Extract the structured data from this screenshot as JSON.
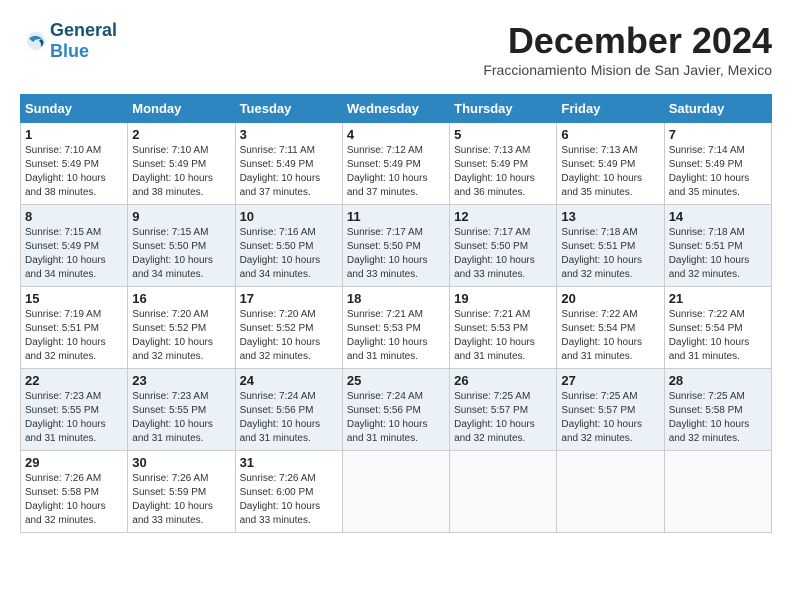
{
  "header": {
    "logo_general": "General",
    "logo_blue": "Blue",
    "month_title": "December 2024",
    "subtitle": "Fraccionamiento Mision de San Javier, Mexico"
  },
  "days_of_week": [
    "Sunday",
    "Monday",
    "Tuesday",
    "Wednesday",
    "Thursday",
    "Friday",
    "Saturday"
  ],
  "weeks": [
    [
      {
        "day": "1",
        "info": "Sunrise: 7:10 AM\nSunset: 5:49 PM\nDaylight: 10 hours\nand 38 minutes."
      },
      {
        "day": "2",
        "info": "Sunrise: 7:10 AM\nSunset: 5:49 PM\nDaylight: 10 hours\nand 38 minutes."
      },
      {
        "day": "3",
        "info": "Sunrise: 7:11 AM\nSunset: 5:49 PM\nDaylight: 10 hours\nand 37 minutes."
      },
      {
        "day": "4",
        "info": "Sunrise: 7:12 AM\nSunset: 5:49 PM\nDaylight: 10 hours\nand 37 minutes."
      },
      {
        "day": "5",
        "info": "Sunrise: 7:13 AM\nSunset: 5:49 PM\nDaylight: 10 hours\nand 36 minutes."
      },
      {
        "day": "6",
        "info": "Sunrise: 7:13 AM\nSunset: 5:49 PM\nDaylight: 10 hours\nand 35 minutes."
      },
      {
        "day": "7",
        "info": "Sunrise: 7:14 AM\nSunset: 5:49 PM\nDaylight: 10 hours\nand 35 minutes."
      }
    ],
    [
      {
        "day": "8",
        "info": "Sunrise: 7:15 AM\nSunset: 5:49 PM\nDaylight: 10 hours\nand 34 minutes."
      },
      {
        "day": "9",
        "info": "Sunrise: 7:15 AM\nSunset: 5:50 PM\nDaylight: 10 hours\nand 34 minutes."
      },
      {
        "day": "10",
        "info": "Sunrise: 7:16 AM\nSunset: 5:50 PM\nDaylight: 10 hours\nand 34 minutes."
      },
      {
        "day": "11",
        "info": "Sunrise: 7:17 AM\nSunset: 5:50 PM\nDaylight: 10 hours\nand 33 minutes."
      },
      {
        "day": "12",
        "info": "Sunrise: 7:17 AM\nSunset: 5:50 PM\nDaylight: 10 hours\nand 33 minutes."
      },
      {
        "day": "13",
        "info": "Sunrise: 7:18 AM\nSunset: 5:51 PM\nDaylight: 10 hours\nand 32 minutes."
      },
      {
        "day": "14",
        "info": "Sunrise: 7:18 AM\nSunset: 5:51 PM\nDaylight: 10 hours\nand 32 minutes."
      }
    ],
    [
      {
        "day": "15",
        "info": "Sunrise: 7:19 AM\nSunset: 5:51 PM\nDaylight: 10 hours\nand 32 minutes."
      },
      {
        "day": "16",
        "info": "Sunrise: 7:20 AM\nSunset: 5:52 PM\nDaylight: 10 hours\nand 32 minutes."
      },
      {
        "day": "17",
        "info": "Sunrise: 7:20 AM\nSunset: 5:52 PM\nDaylight: 10 hours\nand 32 minutes."
      },
      {
        "day": "18",
        "info": "Sunrise: 7:21 AM\nSunset: 5:53 PM\nDaylight: 10 hours\nand 31 minutes."
      },
      {
        "day": "19",
        "info": "Sunrise: 7:21 AM\nSunset: 5:53 PM\nDaylight: 10 hours\nand 31 minutes."
      },
      {
        "day": "20",
        "info": "Sunrise: 7:22 AM\nSunset: 5:54 PM\nDaylight: 10 hours\nand 31 minutes."
      },
      {
        "day": "21",
        "info": "Sunrise: 7:22 AM\nSunset: 5:54 PM\nDaylight: 10 hours\nand 31 minutes."
      }
    ],
    [
      {
        "day": "22",
        "info": "Sunrise: 7:23 AM\nSunset: 5:55 PM\nDaylight: 10 hours\nand 31 minutes."
      },
      {
        "day": "23",
        "info": "Sunrise: 7:23 AM\nSunset: 5:55 PM\nDaylight: 10 hours\nand 31 minutes."
      },
      {
        "day": "24",
        "info": "Sunrise: 7:24 AM\nSunset: 5:56 PM\nDaylight: 10 hours\nand 31 minutes."
      },
      {
        "day": "25",
        "info": "Sunrise: 7:24 AM\nSunset: 5:56 PM\nDaylight: 10 hours\nand 31 minutes."
      },
      {
        "day": "26",
        "info": "Sunrise: 7:25 AM\nSunset: 5:57 PM\nDaylight: 10 hours\nand 32 minutes."
      },
      {
        "day": "27",
        "info": "Sunrise: 7:25 AM\nSunset: 5:57 PM\nDaylight: 10 hours\nand 32 minutes."
      },
      {
        "day": "28",
        "info": "Sunrise: 7:25 AM\nSunset: 5:58 PM\nDaylight: 10 hours\nand 32 minutes."
      }
    ],
    [
      {
        "day": "29",
        "info": "Sunrise: 7:26 AM\nSunset: 5:58 PM\nDaylight: 10 hours\nand 32 minutes."
      },
      {
        "day": "30",
        "info": "Sunrise: 7:26 AM\nSunset: 5:59 PM\nDaylight: 10 hours\nand 33 minutes."
      },
      {
        "day": "31",
        "info": "Sunrise: 7:26 AM\nSunset: 6:00 PM\nDaylight: 10 hours\nand 33 minutes."
      },
      {
        "day": "",
        "info": ""
      },
      {
        "day": "",
        "info": ""
      },
      {
        "day": "",
        "info": ""
      },
      {
        "day": "",
        "info": ""
      }
    ]
  ]
}
